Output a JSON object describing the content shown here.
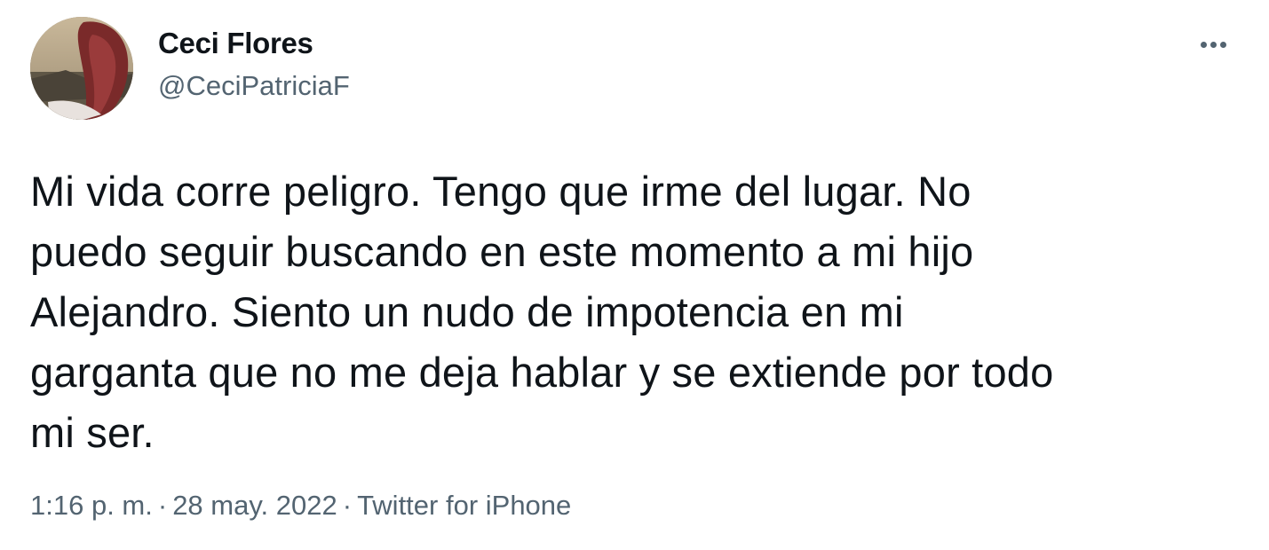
{
  "author": {
    "display_name": "Ceci Flores",
    "handle": "@CeciPatriciaF"
  },
  "icons": {
    "avatar": "profile-photo",
    "more": "more-options-icon"
  },
  "tweet": {
    "text": "Mi vida corre peligro. Tengo que irme del lugar. No\npuedo seguir buscando en este momento a mi hijo\nAlejandro. Siento un nudo de impotencia en mi\ngarganta que no me deja hablar y se extiende por todo\nmi ser."
  },
  "meta": {
    "time": "1:16 p. m.",
    "separator": "·",
    "date": "28 may. 2022",
    "source": "Twitter for iPhone"
  },
  "colors": {
    "text_primary": "#0f1419",
    "text_secondary": "#536471",
    "background": "#ffffff"
  }
}
